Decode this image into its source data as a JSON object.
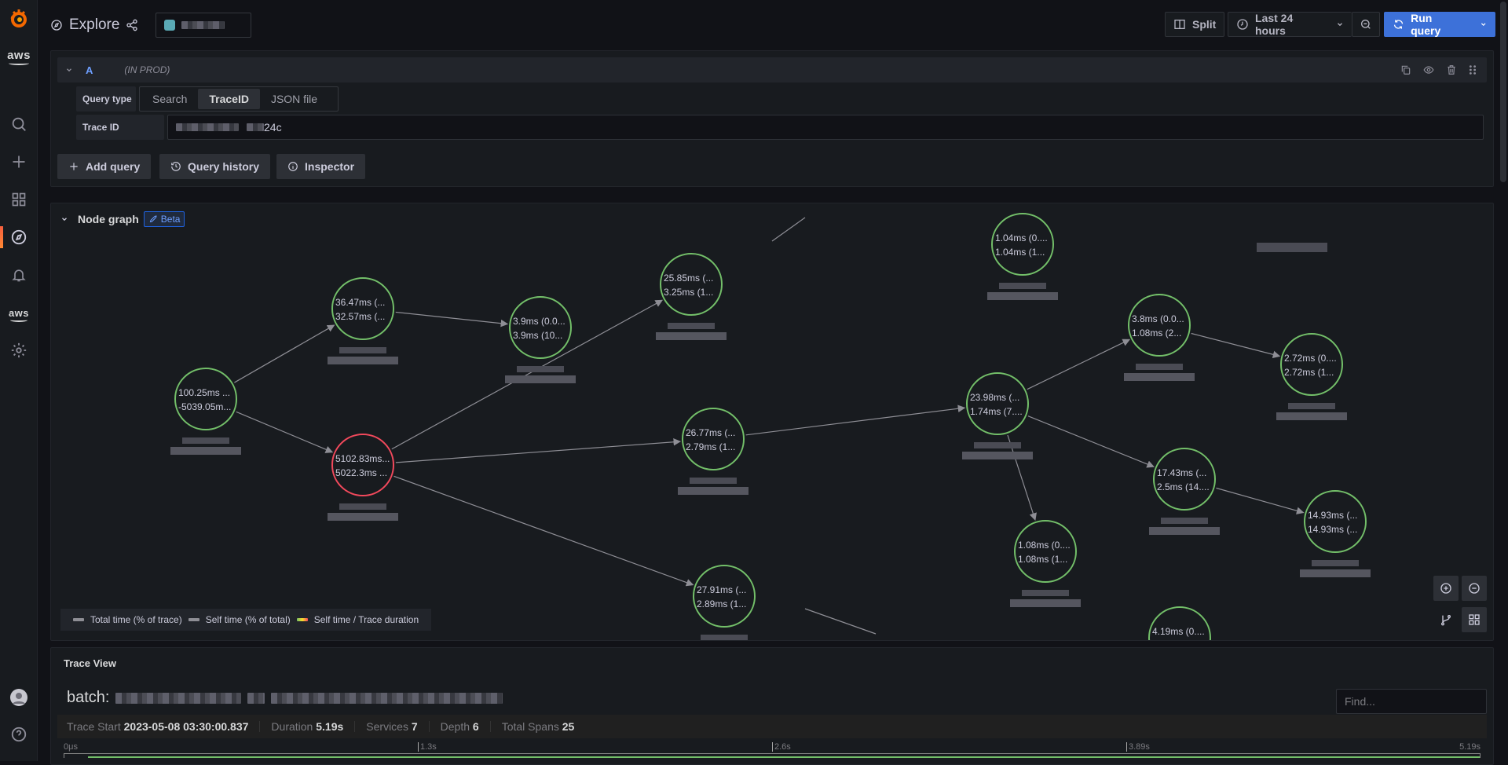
{
  "sidebar": {
    "items": [
      {
        "name": "grafana-logo",
        "label": ""
      },
      {
        "name": "aws-logo",
        "label": "aws"
      },
      {
        "name": "search",
        "label": "Search"
      },
      {
        "name": "create",
        "label": "Create"
      },
      {
        "name": "dashboards",
        "label": "Dashboards"
      },
      {
        "name": "explore",
        "label": "Explore",
        "active": true
      },
      {
        "name": "alerting",
        "label": "Alerting"
      },
      {
        "name": "aws-services",
        "label": "aws"
      },
      {
        "name": "configuration",
        "label": "Configuration"
      }
    ],
    "bottom": [
      {
        "name": "profile",
        "label": "Profile"
      },
      {
        "name": "help",
        "label": "Help"
      }
    ]
  },
  "header": {
    "title": "Explore",
    "datasource": "[redacted]",
    "split_label": "Split",
    "time_range": "Last 24 hours",
    "run_query_label": "Run query"
  },
  "query": {
    "ref_id": "A",
    "datasource_note": "(IN PROD)",
    "query_type_label": "Query type",
    "query_type_options": [
      "Search",
      "TraceID",
      "JSON file"
    ],
    "query_type_selected": "TraceID",
    "trace_id_label": "Trace ID",
    "trace_id_value_visible_suffix": "24c",
    "add_query_label": "Add query",
    "query_history_label": "Query history",
    "inspector_label": "Inspector"
  },
  "node_graph": {
    "title": "Node graph",
    "badge": "Beta",
    "legend": [
      "Total time (% of trace)",
      "Self time (% of total)",
      "Self time / Trace duration"
    ],
    "nodes": [
      {
        "id": "n1",
        "line1": "100.25ms ...",
        "line2": "-5039.05m...",
        "sub": "batch",
        "status": "ok"
      },
      {
        "id": "n2",
        "line1": "36.47ms (...",
        "line2": "32.57ms (...",
        "sub": "",
        "status": "ok"
      },
      {
        "id": "n3",
        "line1": "5102.83ms...",
        "line2": "5022.3ms ...",
        "sub": "",
        "status": "error"
      },
      {
        "id": "n4",
        "line1": "3.9ms (0.0...",
        "line2": "3.9ms (10...",
        "sub": "",
        "status": "ok"
      },
      {
        "id": "n5",
        "line1": "25.85ms (...",
        "line2": "3.25ms (1...",
        "sub": "batch",
        "status": "ok"
      },
      {
        "id": "n6",
        "line1": "26.77ms (...",
        "line2": "2.79ms (1...",
        "sub": "",
        "status": "ok"
      },
      {
        "id": "n7",
        "line1": "27.91ms (...",
        "line2": "2.89ms (1...",
        "sub": "",
        "status": "ok"
      },
      {
        "id": "n8",
        "line1": "1.04ms (0....",
        "line2": "1.04ms (1...",
        "sub": "",
        "status": "ok"
      },
      {
        "id": "n9",
        "line1": "23.98ms (...",
        "line2": "1.74ms (7....",
        "sub": "gateway",
        "status": "ok"
      },
      {
        "id": "n10",
        "line1": "1.08ms (0....",
        "line2": "1.08ms (1...",
        "sub": "",
        "status": "ok"
      },
      {
        "id": "n11",
        "line1": "3.8ms (0.0...",
        "line2": "1.08ms (2...",
        "sub": "gateway",
        "status": "ok"
      },
      {
        "id": "n12",
        "line1": "2.72ms (0....",
        "line2": "2.72ms (1...",
        "sub": "",
        "status": "ok"
      },
      {
        "id": "n13",
        "line1": "17.43ms (...",
        "line2": "2.5ms (14....",
        "sub": "",
        "status": "ok"
      },
      {
        "id": "n14",
        "line1": "14.93ms (...",
        "line2": "14.93ms (...",
        "sub": "",
        "status": "ok"
      },
      {
        "id": "n15",
        "line1": "4.19ms (0....",
        "line2": "",
        "sub": "",
        "status": "ok"
      }
    ],
    "edges": [
      [
        "n1",
        "n2"
      ],
      [
        "n1",
        "n3"
      ],
      [
        "n2",
        "n4"
      ],
      [
        "n3",
        "n5"
      ],
      [
        "n3",
        "n6"
      ],
      [
        "n3",
        "n7"
      ],
      [
        "n6",
        "n9"
      ],
      [
        "n9",
        "n11"
      ],
      [
        "n9",
        "n13"
      ],
      [
        "n9",
        "n10"
      ],
      [
        "n11",
        "n12"
      ],
      [
        "n13",
        "n14"
      ]
    ],
    "colors": {
      "ok": "#73bf69",
      "error": "#f2495c",
      "edge": "#8e8e95"
    }
  },
  "trace_view": {
    "title": "Trace View",
    "trace_name_prefix": "batch:",
    "find_placeholder": "Find...",
    "stats": [
      {
        "label": "Trace Start",
        "value": "2023-05-08 03:30:00.837"
      },
      {
        "label": "Duration",
        "value": "5.19s"
      },
      {
        "label": "Services",
        "value": "7"
      },
      {
        "label": "Depth",
        "value": "6"
      },
      {
        "label": "Total Spans",
        "value": "25"
      }
    ],
    "ticks": [
      "0μs",
      "1.3s",
      "2.6s",
      "3.89s",
      "5.19s"
    ]
  }
}
